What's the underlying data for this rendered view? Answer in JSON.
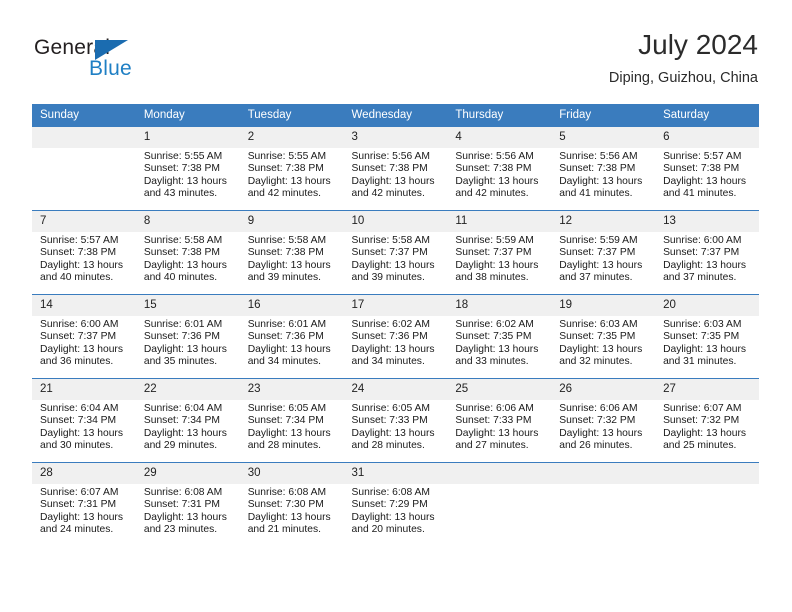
{
  "brand": {
    "name_top": "General",
    "name_bottom": "Blue",
    "triangle_color": "#1b6cb0",
    "blue_color": "#1f7fc4",
    "dark_color": "#231f20"
  },
  "header": {
    "title": "July 2024",
    "subtitle": "Diping, Guizhou, China"
  },
  "theme": {
    "header_bg": "#3a7cbe",
    "header_text": "#ffffff",
    "daynum_bg": "#f0f0f0",
    "row_border": "#3a7cbe"
  },
  "weekdays": [
    "Sunday",
    "Monday",
    "Tuesday",
    "Wednesday",
    "Thursday",
    "Friday",
    "Saturday"
  ],
  "weeks": [
    [
      {
        "day": "",
        "sunrise": "",
        "sunset": "",
        "daylight1": "",
        "daylight2": ""
      },
      {
        "day": "1",
        "sunrise": "Sunrise: 5:55 AM",
        "sunset": "Sunset: 7:38 PM",
        "daylight1": "Daylight: 13 hours",
        "daylight2": "and 43 minutes."
      },
      {
        "day": "2",
        "sunrise": "Sunrise: 5:55 AM",
        "sunset": "Sunset: 7:38 PM",
        "daylight1": "Daylight: 13 hours",
        "daylight2": "and 42 minutes."
      },
      {
        "day": "3",
        "sunrise": "Sunrise: 5:56 AM",
        "sunset": "Sunset: 7:38 PM",
        "daylight1": "Daylight: 13 hours",
        "daylight2": "and 42 minutes."
      },
      {
        "day": "4",
        "sunrise": "Sunrise: 5:56 AM",
        "sunset": "Sunset: 7:38 PM",
        "daylight1": "Daylight: 13 hours",
        "daylight2": "and 42 minutes."
      },
      {
        "day": "5",
        "sunrise": "Sunrise: 5:56 AM",
        "sunset": "Sunset: 7:38 PM",
        "daylight1": "Daylight: 13 hours",
        "daylight2": "and 41 minutes."
      },
      {
        "day": "6",
        "sunrise": "Sunrise: 5:57 AM",
        "sunset": "Sunset: 7:38 PM",
        "daylight1": "Daylight: 13 hours",
        "daylight2": "and 41 minutes."
      }
    ],
    [
      {
        "day": "7",
        "sunrise": "Sunrise: 5:57 AM",
        "sunset": "Sunset: 7:38 PM",
        "daylight1": "Daylight: 13 hours",
        "daylight2": "and 40 minutes."
      },
      {
        "day": "8",
        "sunrise": "Sunrise: 5:58 AM",
        "sunset": "Sunset: 7:38 PM",
        "daylight1": "Daylight: 13 hours",
        "daylight2": "and 40 minutes."
      },
      {
        "day": "9",
        "sunrise": "Sunrise: 5:58 AM",
        "sunset": "Sunset: 7:38 PM",
        "daylight1": "Daylight: 13 hours",
        "daylight2": "and 39 minutes."
      },
      {
        "day": "10",
        "sunrise": "Sunrise: 5:58 AM",
        "sunset": "Sunset: 7:37 PM",
        "daylight1": "Daylight: 13 hours",
        "daylight2": "and 39 minutes."
      },
      {
        "day": "11",
        "sunrise": "Sunrise: 5:59 AM",
        "sunset": "Sunset: 7:37 PM",
        "daylight1": "Daylight: 13 hours",
        "daylight2": "and 38 minutes."
      },
      {
        "day": "12",
        "sunrise": "Sunrise: 5:59 AM",
        "sunset": "Sunset: 7:37 PM",
        "daylight1": "Daylight: 13 hours",
        "daylight2": "and 37 minutes."
      },
      {
        "day": "13",
        "sunrise": "Sunrise: 6:00 AM",
        "sunset": "Sunset: 7:37 PM",
        "daylight1": "Daylight: 13 hours",
        "daylight2": "and 37 minutes."
      }
    ],
    [
      {
        "day": "14",
        "sunrise": "Sunrise: 6:00 AM",
        "sunset": "Sunset: 7:37 PM",
        "daylight1": "Daylight: 13 hours",
        "daylight2": "and 36 minutes."
      },
      {
        "day": "15",
        "sunrise": "Sunrise: 6:01 AM",
        "sunset": "Sunset: 7:36 PM",
        "daylight1": "Daylight: 13 hours",
        "daylight2": "and 35 minutes."
      },
      {
        "day": "16",
        "sunrise": "Sunrise: 6:01 AM",
        "sunset": "Sunset: 7:36 PM",
        "daylight1": "Daylight: 13 hours",
        "daylight2": "and 34 minutes."
      },
      {
        "day": "17",
        "sunrise": "Sunrise: 6:02 AM",
        "sunset": "Sunset: 7:36 PM",
        "daylight1": "Daylight: 13 hours",
        "daylight2": "and 34 minutes."
      },
      {
        "day": "18",
        "sunrise": "Sunrise: 6:02 AM",
        "sunset": "Sunset: 7:35 PM",
        "daylight1": "Daylight: 13 hours",
        "daylight2": "and 33 minutes."
      },
      {
        "day": "19",
        "sunrise": "Sunrise: 6:03 AM",
        "sunset": "Sunset: 7:35 PM",
        "daylight1": "Daylight: 13 hours",
        "daylight2": "and 32 minutes."
      },
      {
        "day": "20",
        "sunrise": "Sunrise: 6:03 AM",
        "sunset": "Sunset: 7:35 PM",
        "daylight1": "Daylight: 13 hours",
        "daylight2": "and 31 minutes."
      }
    ],
    [
      {
        "day": "21",
        "sunrise": "Sunrise: 6:04 AM",
        "sunset": "Sunset: 7:34 PM",
        "daylight1": "Daylight: 13 hours",
        "daylight2": "and 30 minutes."
      },
      {
        "day": "22",
        "sunrise": "Sunrise: 6:04 AM",
        "sunset": "Sunset: 7:34 PM",
        "daylight1": "Daylight: 13 hours",
        "daylight2": "and 29 minutes."
      },
      {
        "day": "23",
        "sunrise": "Sunrise: 6:05 AM",
        "sunset": "Sunset: 7:34 PM",
        "daylight1": "Daylight: 13 hours",
        "daylight2": "and 28 minutes."
      },
      {
        "day": "24",
        "sunrise": "Sunrise: 6:05 AM",
        "sunset": "Sunset: 7:33 PM",
        "daylight1": "Daylight: 13 hours",
        "daylight2": "and 28 minutes."
      },
      {
        "day": "25",
        "sunrise": "Sunrise: 6:06 AM",
        "sunset": "Sunset: 7:33 PM",
        "daylight1": "Daylight: 13 hours",
        "daylight2": "and 27 minutes."
      },
      {
        "day": "26",
        "sunrise": "Sunrise: 6:06 AM",
        "sunset": "Sunset: 7:32 PM",
        "daylight1": "Daylight: 13 hours",
        "daylight2": "and 26 minutes."
      },
      {
        "day": "27",
        "sunrise": "Sunrise: 6:07 AM",
        "sunset": "Sunset: 7:32 PM",
        "daylight1": "Daylight: 13 hours",
        "daylight2": "and 25 minutes."
      }
    ],
    [
      {
        "day": "28",
        "sunrise": "Sunrise: 6:07 AM",
        "sunset": "Sunset: 7:31 PM",
        "daylight1": "Daylight: 13 hours",
        "daylight2": "and 24 minutes."
      },
      {
        "day": "29",
        "sunrise": "Sunrise: 6:08 AM",
        "sunset": "Sunset: 7:31 PM",
        "daylight1": "Daylight: 13 hours",
        "daylight2": "and 23 minutes."
      },
      {
        "day": "30",
        "sunrise": "Sunrise: 6:08 AM",
        "sunset": "Sunset: 7:30 PM",
        "daylight1": "Daylight: 13 hours",
        "daylight2": "and 21 minutes."
      },
      {
        "day": "31",
        "sunrise": "Sunrise: 6:08 AM",
        "sunset": "Sunset: 7:29 PM",
        "daylight1": "Daylight: 13 hours",
        "daylight2": "and 20 minutes."
      },
      {
        "day": "",
        "sunrise": "",
        "sunset": "",
        "daylight1": "",
        "daylight2": ""
      },
      {
        "day": "",
        "sunrise": "",
        "sunset": "",
        "daylight1": "",
        "daylight2": ""
      },
      {
        "day": "",
        "sunrise": "",
        "sunset": "",
        "daylight1": "",
        "daylight2": ""
      }
    ]
  ]
}
